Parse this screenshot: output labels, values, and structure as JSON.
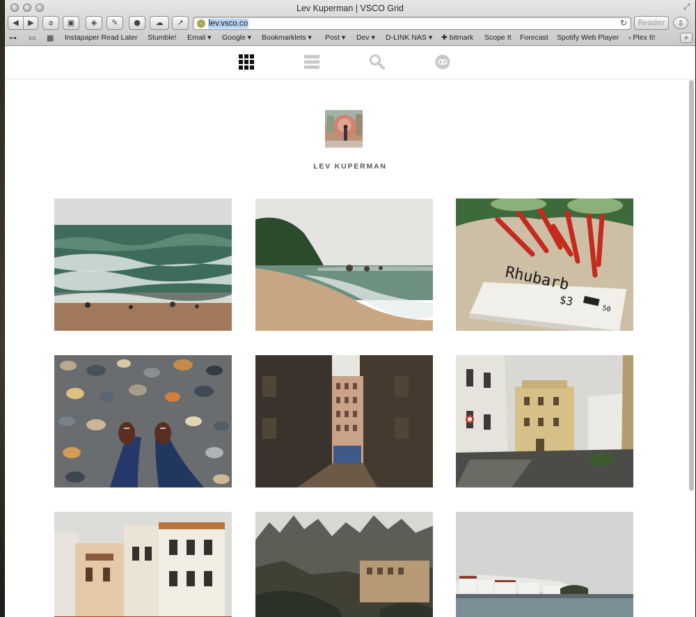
{
  "window": {
    "title": "Lev Kuperman | VSCO Grid"
  },
  "toolbar": {
    "back_icon": "back-arrow",
    "forward_icon": "forward-arrow",
    "url": "lev.vsco.co",
    "reader_label": "Reader"
  },
  "bookmarks": {
    "items": [
      {
        "label": "Instapaper Read Later"
      },
      {
        "label": "Stumble!"
      },
      {
        "label": "Email ▾"
      },
      {
        "label": "Google ▾"
      },
      {
        "label": "Bookmarklets ▾"
      },
      {
        "label": "Post ▾"
      },
      {
        "label": "Dev ▾"
      },
      {
        "label": "D-LINK NAS ▾"
      },
      {
        "label": "✚ bitmark"
      },
      {
        "label": "Scope It"
      },
      {
        "label": "Forecast"
      },
      {
        "label": "Spotify Web Player"
      },
      {
        "label": "› Plex It!"
      }
    ]
  },
  "site_nav": {
    "items": [
      {
        "name": "grid-view",
        "active": true
      },
      {
        "name": "list-view",
        "active": false
      },
      {
        "name": "search",
        "active": false
      },
      {
        "name": "vsco-link",
        "active": false
      }
    ]
  },
  "profile": {
    "name": "LEV KUPERMAN"
  },
  "photos": [
    {
      "subject": "stormy green sea waves on pebble shore"
    },
    {
      "subject": "pebble beach with green hill and calm sea"
    },
    {
      "subject": "red rhubarb stalks with Rhubarb sign"
    },
    {
      "subject": "feet in sneakers on colorful pebbles"
    },
    {
      "subject": "narrow city alley between buildings"
    },
    {
      "subject": "cobblestone street with old buildings"
    },
    {
      "subject": "ornate seaside building facades"
    },
    {
      "subject": "jagged mountain range with monastery"
    },
    {
      "subject": "white seaside village and calm water"
    }
  ],
  "colors": {
    "accent_icon_active": "#111111",
    "icon_inactive": "#c8c8c8",
    "username_text": "#555555"
  }
}
